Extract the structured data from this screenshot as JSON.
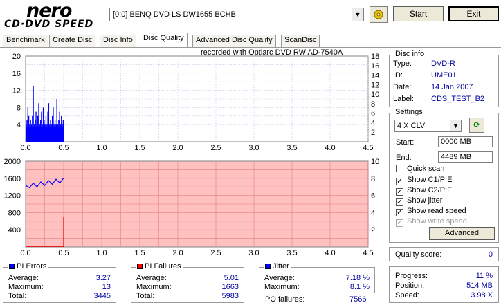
{
  "logo": {
    "top": "nero",
    "bottom": "CD·DVD SPEED"
  },
  "toolbar": {
    "drive": "[0:0]  BENQ DVD LS DW1655 BCHB",
    "start_label": "Start",
    "exit_label": "Exit"
  },
  "tabs": [
    {
      "label": "Benchmark"
    },
    {
      "label": "Create Disc"
    },
    {
      "label": "Disc Info"
    },
    {
      "label": "Disc Quality"
    },
    {
      "label": "Advanced Disc Quality"
    },
    {
      "label": "ScanDisc"
    }
  ],
  "chart": {
    "recorded_with": "recorded with Optiarc  DVD RW AD-7540A"
  },
  "chart_data": [
    {
      "type": "bar",
      "name": "pi-errors-chart",
      "y_left_ticks": [
        "20",
        "16",
        "12",
        "8",
        "4"
      ],
      "y_right_ticks": [
        "18",
        "16",
        "14",
        "12",
        "10",
        "8",
        "6",
        "4",
        "2"
      ],
      "x_ticks": [
        "0.0",
        "0.5",
        "1.0",
        "1.5",
        "2.0",
        "2.5",
        "3.0",
        "3.5",
        "4.0",
        "4.5"
      ],
      "xlim": [
        0,
        4.5
      ],
      "ylim": [
        0,
        20
      ],
      "colors": {
        "background": "#ffffff",
        "bars": "#0000ff",
        "line": "#000080"
      },
      "bar_heights": [
        4,
        5,
        8,
        6,
        4,
        5,
        4,
        6,
        13,
        4,
        5,
        7,
        4,
        6,
        9,
        4,
        5,
        7,
        4,
        8,
        5,
        4,
        6,
        4,
        7,
        9,
        4,
        5,
        4,
        6,
        8,
        4,
        5,
        4,
        10,
        4,
        5,
        7,
        4,
        6,
        4,
        5
      ],
      "extent_x": 0.5
    },
    {
      "type": "line",
      "name": "jitter-failures-chart",
      "y_left_ticks": [
        "2000",
        "1600",
        "1200",
        "800",
        "400"
      ],
      "y_right_ticks": [
        "10",
        "8",
        "6",
        "4",
        "2"
      ],
      "x_ticks": [
        "0.0",
        "0.5",
        "1.0",
        "1.5",
        "2.0",
        "2.5",
        "3.0",
        "3.5",
        "4.0",
        "4.5"
      ],
      "xlim": [
        0,
        4.5
      ],
      "ylim": [
        0,
        2000
      ],
      "colors": {
        "background": "#ffc0c0",
        "line": "#0000ff",
        "spike": "#ff0000"
      },
      "x": [
        0.0,
        0.05,
        0.1,
        0.15,
        0.2,
        0.25,
        0.3,
        0.35,
        0.4,
        0.45,
        0.5
      ],
      "y": [
        1390,
        1430,
        1440,
        1450,
        1470,
        1480,
        1500,
        1510,
        1530,
        1540,
        1560
      ],
      "spike_x": 0.5,
      "spike_y": 1663
    }
  ],
  "disc_info": {
    "title": "Disc info",
    "type_label": "Type:",
    "type_value": "DVD-R",
    "id_label": "ID:",
    "id_value": "UME01",
    "date_label": "Date:",
    "date_value": "14 Jan 2007",
    "label_label": "Label:",
    "label_value": "CDS_TEST_B2"
  },
  "settings": {
    "title": "Settings",
    "speed": "4 X CLV",
    "start_label": "Start:",
    "start_value": "0000 MB",
    "end_label": "End:",
    "end_value": "4489 MB",
    "checks": [
      {
        "label": "Quick scan",
        "checked": false,
        "disabled": false
      },
      {
        "label": "Show C1/PIE",
        "checked": true,
        "disabled": false
      },
      {
        "label": "Show C2/PIF",
        "checked": true,
        "disabled": false
      },
      {
        "label": "Show jitter",
        "checked": true,
        "disabled": false
      },
      {
        "label": "Show read speed",
        "checked": true,
        "disabled": false
      },
      {
        "label": "Show write speed",
        "checked": true,
        "disabled": true
      }
    ],
    "advanced_label": "Advanced"
  },
  "quality": {
    "label": "Quality score:",
    "value": "0"
  },
  "progress": {
    "progress_label": "Progress:",
    "progress_value": "11 %",
    "position_label": "Position:",
    "position_value": "514 MB",
    "speed_label": "Speed:",
    "speed_value": "3.98 X"
  },
  "pi_errors": {
    "title": "PI Errors",
    "color": "#0000ff",
    "average_label": "Average:",
    "average": "3.27",
    "maximum_label": "Maximum:",
    "maximum": "13",
    "total_label": "Total:",
    "total": "3445"
  },
  "pi_failures": {
    "title": "PI Failures",
    "color": "#ff0000",
    "average_label": "Average:",
    "average": "5.01",
    "maximum_label": "Maximum:",
    "maximum": "1663",
    "total_label": "Total:",
    "total": "5983"
  },
  "jitter": {
    "title": "Jitter",
    "color": "#0000ff",
    "average_label": "Average:",
    "average": "7.18 %",
    "maximum_label": "Maximum:",
    "maximum": "8.1 %"
  },
  "po_failures": {
    "label": "PO failures:",
    "value": "7566"
  }
}
